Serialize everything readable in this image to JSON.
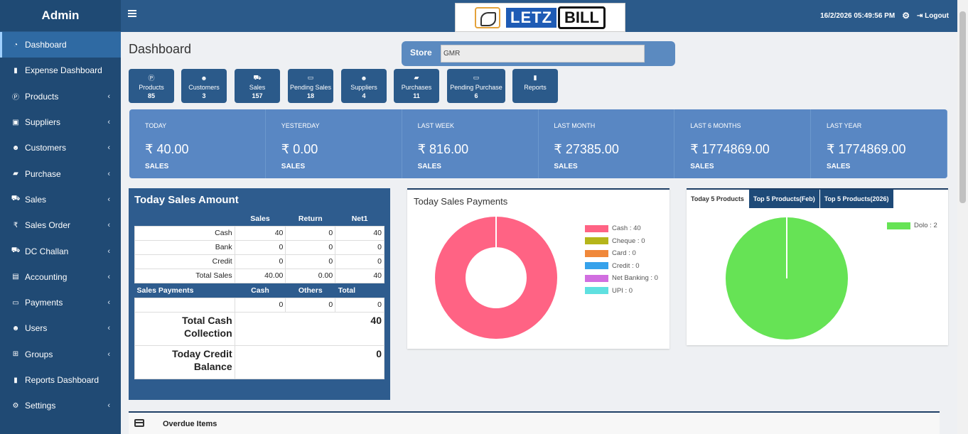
{
  "sidebar": {
    "brand": "Admin",
    "items": [
      {
        "label": "Dashboard",
        "icon": "dashboard-icon",
        "chevron": false,
        "active": true
      },
      {
        "label": "Expense Dashboard",
        "icon": "bar-chart-icon",
        "chevron": false
      },
      {
        "label": "Products",
        "icon": "product-icon",
        "chevron": true
      },
      {
        "label": "Suppliers",
        "icon": "box-icon",
        "chevron": true
      },
      {
        "label": "Customers",
        "icon": "customers-icon",
        "chevron": true
      },
      {
        "label": "Purchase",
        "icon": "bag-icon",
        "chevron": true
      },
      {
        "label": "Sales",
        "icon": "cart-icon",
        "chevron": true
      },
      {
        "label": "Sales Order",
        "icon": "rupee-icon",
        "chevron": true
      },
      {
        "label": "DC Challan",
        "icon": "truck-icon",
        "chevron": true
      },
      {
        "label": "Accounting",
        "icon": "book-icon",
        "chevron": true
      },
      {
        "label": "Payments",
        "icon": "money-icon",
        "chevron": true
      },
      {
        "label": "Users",
        "icon": "users-icon",
        "chevron": true
      },
      {
        "label": "Groups",
        "icon": "groups-icon",
        "chevron": true
      },
      {
        "label": "Reports Dashboard",
        "icon": "bar-chart-icon",
        "chevron": false
      },
      {
        "label": "Settings",
        "icon": "settings-icon",
        "chevron": true
      }
    ],
    "chevron_glyph": "‹"
  },
  "header": {
    "logo_left": "LETZ",
    "logo_right": "BILL",
    "datetime": "16/2/2026 05:49:56 PM",
    "logout": "Logout",
    "gear_glyph": "⚙",
    "logout_glyph": "⇥"
  },
  "page": {
    "title": "Dashboard"
  },
  "store": {
    "label": "Store",
    "value": "GMR"
  },
  "tiles": [
    {
      "label": "Products",
      "count": "85",
      "icon": "product-icon"
    },
    {
      "label": "Customers",
      "count": "3",
      "icon": "customers-icon"
    },
    {
      "label": "Sales",
      "count": "157",
      "icon": "cart-icon"
    },
    {
      "label": "Pending Sales",
      "count": "18",
      "icon": "card-icon"
    },
    {
      "label": "Suppliers",
      "count": "4",
      "icon": "customers-icon"
    },
    {
      "label": "Purchases",
      "count": "11",
      "icon": "bag-icon"
    },
    {
      "label": "Pending Purchase",
      "count": "6",
      "icon": "card-icon"
    },
    {
      "label": "Reports",
      "count": "",
      "icon": "bar-chart-icon"
    }
  ],
  "stats": [
    {
      "label": "TODAY",
      "value": "₹ 40.00",
      "sub": "SALES"
    },
    {
      "label": "YESTERDAY",
      "value": "₹ 0.00",
      "sub": "SALES"
    },
    {
      "label": "LAST WEEK",
      "value": "₹ 816.00",
      "sub": "SALES"
    },
    {
      "label": "LAST MONTH",
      "value": "₹ 27385.00",
      "sub": "SALES"
    },
    {
      "label": "LAST 6 MONTHS",
      "value": "₹ 1774869.00",
      "sub": "SALES"
    },
    {
      "label": "LAST YEAR",
      "value": "₹ 1774869.00",
      "sub": "SALES"
    }
  ],
  "today_sales": {
    "title": "Today Sales Amount",
    "headers": [
      "",
      "Sales",
      "Return",
      "Net1"
    ],
    "rows": [
      {
        "label": "Cash",
        "sales": "40",
        "return": "0",
        "net": "40"
      },
      {
        "label": "Bank",
        "sales": "0",
        "return": "0",
        "net": "0"
      },
      {
        "label": "Credit",
        "sales": "0",
        "return": "0",
        "net": "0"
      },
      {
        "label": "Total Sales",
        "sales": "40.00",
        "return": "0.00",
        "net": "40"
      }
    ],
    "pay_headers": [
      "Sales Payments",
      "Cash",
      "Others",
      "Total"
    ],
    "pay_row": {
      "cash": "0",
      "others": "0",
      "total": "0"
    },
    "total_cash_label": "Total Cash Collection",
    "total_cash_value": "40",
    "credit_label": "Today Credit Balance",
    "credit_value": "0"
  },
  "payments_chart": {
    "title": "Today Sales Payments",
    "legend": [
      {
        "label": "Cash : 40",
        "color": "#ff6384"
      },
      {
        "label": "Cheque : 0",
        "color": "#b5b51a"
      },
      {
        "label": "Card : 0",
        "color": "#f0883a"
      },
      {
        "label": "Credit : 0",
        "color": "#36a2eb"
      },
      {
        "label": "Net Banking : 0",
        "color": "#d16ee0"
      },
      {
        "label": "UPI : 0",
        "color": "#5fe0e0"
      }
    ]
  },
  "products_chart": {
    "tabs": [
      "Today 5 Products",
      "Top 5 Products(Feb)",
      "Top 5 Products(2026)"
    ],
    "legend": [
      {
        "label": "Dolo : 2",
        "color": "#66e355"
      }
    ]
  },
  "chart_data": [
    {
      "type": "pie",
      "title": "Today Sales Payments",
      "categories": [
        "Cash",
        "Cheque",
        "Card",
        "Credit",
        "Net Banking",
        "UPI"
      ],
      "values": [
        40,
        0,
        0,
        0,
        0,
        0
      ]
    },
    {
      "type": "pie",
      "categories": [
        "Dolo"
      ],
      "values": [
        2
      ]
    }
  ],
  "overdue": {
    "title": "Overdue Items"
  }
}
